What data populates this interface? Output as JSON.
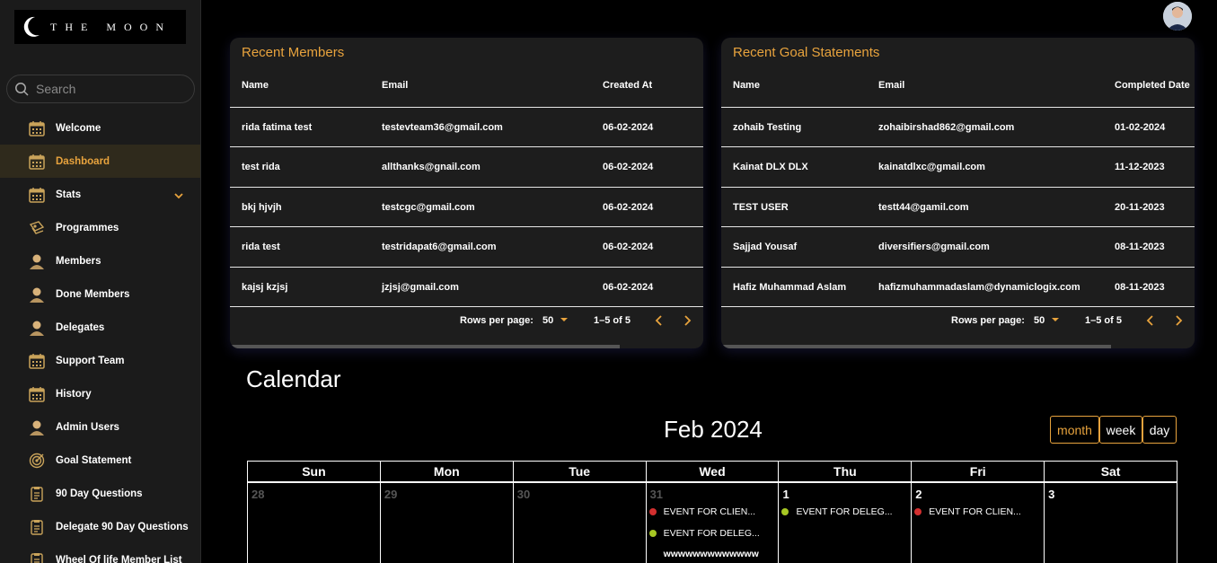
{
  "app": {
    "logo_text": "THE MOON"
  },
  "search": {
    "placeholder": "Search"
  },
  "sidebar": {
    "items": [
      {
        "label": "Welcome",
        "icon": "calendar-icon"
      },
      {
        "label": "Dashboard",
        "icon": "calendar-icon",
        "active": true
      },
      {
        "label": "Stats",
        "icon": "calendar-icon",
        "expandable": true
      },
      {
        "label": "Programmes",
        "icon": "programmes-icon"
      },
      {
        "label": "Members",
        "icon": "user-icon"
      },
      {
        "label": "Done Members",
        "icon": "user-icon"
      },
      {
        "label": "Delegates",
        "icon": "user-icon"
      },
      {
        "label": "Support Team",
        "icon": "calendar-icon"
      },
      {
        "label": "History",
        "icon": "calendar-icon"
      },
      {
        "label": "Admin Users",
        "icon": "user-icon"
      },
      {
        "label": "Goal Statement",
        "icon": "target-icon"
      },
      {
        "label": "90 Day Questions",
        "icon": "clipboard-icon"
      },
      {
        "label": "Delegate 90 Day Questions",
        "icon": "clipboard-icon"
      },
      {
        "label": "Wheel Of life Member List",
        "icon": "clipboard-icon"
      }
    ]
  },
  "recent_members": {
    "title": "Recent Members",
    "columns": [
      "Name",
      "Email",
      "Created At"
    ],
    "rows": [
      [
        "rida fatima test",
        "testevteam36@gmail.com",
        "06-02-2024"
      ],
      [
        "test rida",
        "allthanks@gnail.com",
        "06-02-2024"
      ],
      [
        "bkj hjvjh",
        "testcgc@gmail.com",
        "06-02-2024"
      ],
      [
        "rida test",
        "testridapat6@gmail.com",
        "06-02-2024"
      ],
      [
        "kajsj kzjsj",
        "jzjsj@gmail.com",
        "06-02-2024"
      ]
    ],
    "rows_per_page_label": "Rows per page:",
    "rows_per_page": "50",
    "range": "1–5 of 5"
  },
  "recent_goals": {
    "title": "Recent Goal Statements",
    "columns": [
      "Name",
      "Email",
      "Completed Date"
    ],
    "rows": [
      [
        "zohaib Testing",
        "zohaibirshad862@gmail.com",
        "01-02-2024"
      ],
      [
        "Kainat DLX DLX",
        "kainatdlxc@gmail.com",
        "11-12-2023"
      ],
      [
        "TEST USER",
        "testt44@gamil.com",
        "20-11-2023"
      ],
      [
        "Sajjad Yousaf",
        "diversifiers@gmail.com",
        "08-11-2023"
      ],
      [
        "Hafiz Muhammad Aslam",
        "hafizmuhammadaslam@dynamiclogix.com",
        "08-11-2023"
      ]
    ],
    "rows_per_page_label": "Rows per page:",
    "rows_per_page": "50",
    "range": "1–5 of 5"
  },
  "calendar": {
    "title": "Calendar",
    "month_label": "Feb 2024",
    "views": [
      "month",
      "week",
      "day"
    ],
    "active_view": "month",
    "weekdays": [
      "Sun",
      "Mon",
      "Tue",
      "Wed",
      "Thu",
      "Fri",
      "Sat"
    ],
    "days": [
      "28",
      "29",
      "30",
      "31",
      "1",
      "2",
      "3"
    ],
    "events": {
      "wed_1": "EVENT FOR CLIEN...",
      "wed_2": "EVENT FOR DELEG...",
      "wed_3": "wwwwwwwwwwwww",
      "thu_1": "EVENT FOR DELEG...",
      "fri_1": "EVENT FOR CLIEN..."
    }
  },
  "colors": {
    "accent": "#e8a33d",
    "event_client": "#d32f2f",
    "event_delegate": "#a6c723"
  }
}
